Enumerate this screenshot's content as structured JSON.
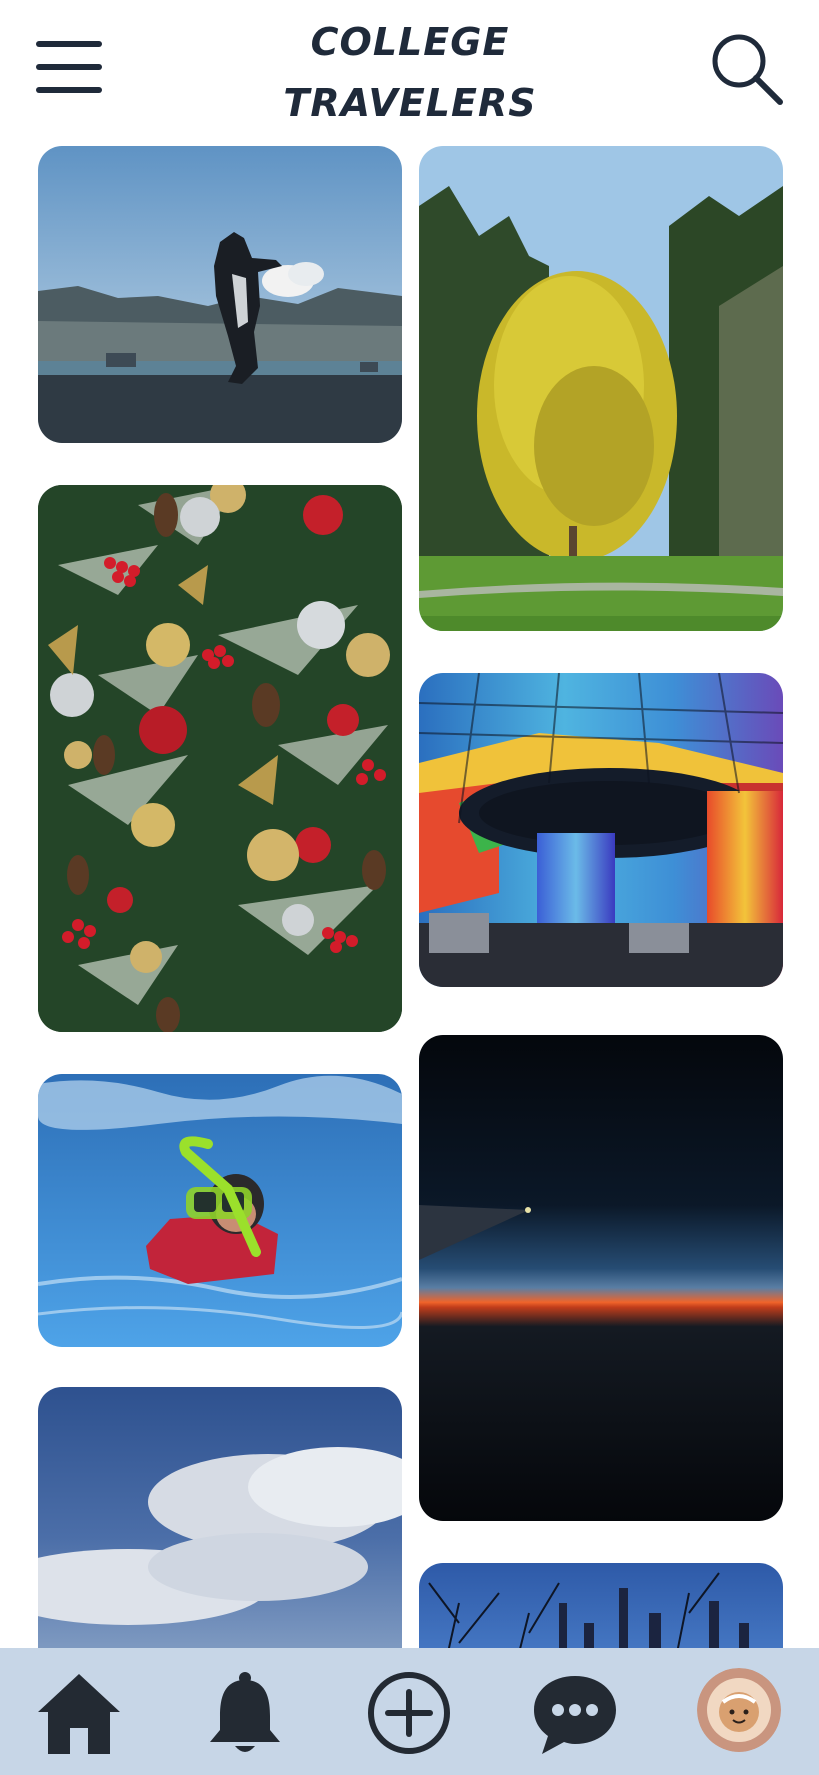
{
  "header": {
    "title_line1": "COLLEGE",
    "title_line2": "TRAVELERS",
    "menu_icon": "hamburger-menu-icon",
    "search_icon": "search-icon"
  },
  "feed": {
    "photos": [
      {
        "subject": "orca-sculpture-waterfront"
      },
      {
        "subject": "autumn-tree-park"
      },
      {
        "subject": "christmas-tree-ornaments"
      },
      {
        "subject": "stained-glass-dome"
      },
      {
        "subject": "snorkeler-in-water"
      },
      {
        "subject": "sunset-from-airplane"
      },
      {
        "subject": "sky-and-clouds"
      },
      {
        "subject": "city-skyline-at-dusk"
      }
    ]
  },
  "bottom_nav": {
    "items": [
      {
        "icon": "home-icon"
      },
      {
        "icon": "bell-icon"
      },
      {
        "icon": "add-post-icon"
      },
      {
        "icon": "chat-icon"
      },
      {
        "icon": "profile-avatar"
      }
    ]
  },
  "colors": {
    "title": "#1f2a3a",
    "nav_background": "#c7d6e7",
    "icon_dark": "#232a33"
  }
}
